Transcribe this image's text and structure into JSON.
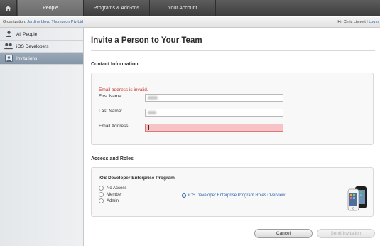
{
  "nav": {
    "tabs": [
      {
        "label": "People",
        "active": true
      },
      {
        "label": "Programs & Add-ons",
        "active": false
      },
      {
        "label": "Your Account",
        "active": false
      }
    ]
  },
  "orgbar": {
    "org_label": "Organization:",
    "org_name": "Jardine Lloyd Thompson Pty Ltd",
    "greeting": "Hi, Chris Lienert |",
    "logout": "Log o"
  },
  "sidebar": {
    "items": [
      {
        "label": "All People",
        "icon": "person-icon",
        "active": false
      },
      {
        "label": "iOS Developers",
        "icon": "people-group-icon",
        "active": false
      },
      {
        "label": "Invitations",
        "icon": "invitation-icon",
        "active": true
      }
    ]
  },
  "main": {
    "title": "Invite a Person to Your Team",
    "contact": {
      "heading": "Contact Information",
      "error": "Email address is invalid.",
      "first_name_label": "First Name:",
      "last_name_label": "Last Name:",
      "email_label": "Email Address:"
    },
    "access": {
      "heading": "Access and Roles",
      "program": "iOS Developer Enterprise Program",
      "roles": [
        "No Access",
        "Member",
        "Admin"
      ],
      "overview_link": "iOS Developer Enterprise Program Roles Overview"
    },
    "buttons": {
      "cancel": "Cancel",
      "send": "Send Invitation"
    }
  },
  "colors": {
    "error": "#c4322c",
    "link": "#2a64a8",
    "error_field": "#f6c3c6"
  }
}
